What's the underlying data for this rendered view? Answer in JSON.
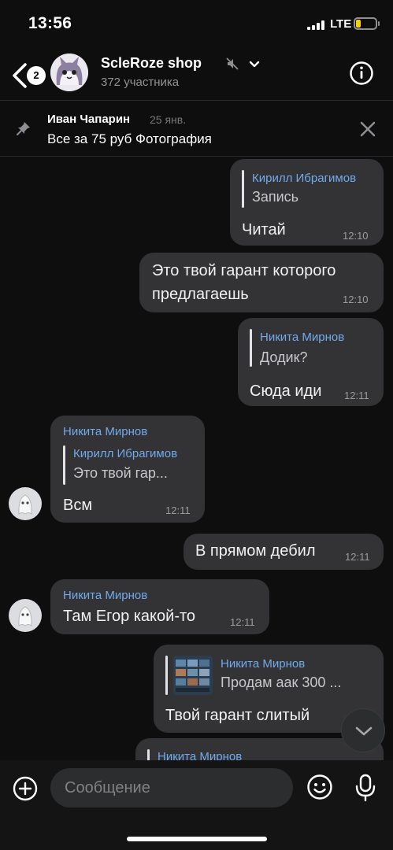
{
  "status_bar": {
    "time": "13:56",
    "network": "LTE",
    "battery_level": 0.25
  },
  "header": {
    "back_badge": "2",
    "title": "ScleRoze shop",
    "subtitle": "372 участника",
    "icons": [
      "back-arrow-icon",
      "muted-speaker-icon",
      "chevron-down-icon",
      "info-icon"
    ]
  },
  "pinned": {
    "author": "Иван Чапарин",
    "date": "25 янв.",
    "text": "Все за 75 руб Фотография"
  },
  "messages": [
    {
      "side": "out",
      "reply_author": "Кирилл Ибрагимов",
      "reply_text": "Запись",
      "text": "Читай",
      "time": "12:10"
    },
    {
      "side": "out",
      "text_line1": "Это твой гарант которого",
      "text_line2": "предлагаешь",
      "time": "12:10"
    },
    {
      "side": "out",
      "reply_author": "Никита Мирнов",
      "reply_text": "Додик?",
      "text": "Сюда иди",
      "time": "12:11"
    },
    {
      "side": "in",
      "sender": "Никита Мирнов",
      "reply_author": "Кирилл Ибрагимов",
      "reply_text": "Это твой гар...",
      "text": "Всм",
      "time": "12:11"
    },
    {
      "side": "out",
      "text": "В прямом дебил",
      "time": "12:11"
    },
    {
      "side": "in",
      "sender": "Никита Мирнов",
      "text": "Там Егор какой-то",
      "time": "12:11"
    },
    {
      "side": "out",
      "reply_author": "Никита Мирнов",
      "reply_text": "Продам аак 300 ...",
      "text": "Твой гарант слитый"
    },
    {
      "side": "out",
      "reply_author": "Никита Мирнов"
    }
  ],
  "composer": {
    "placeholder": "Сообщение"
  }
}
